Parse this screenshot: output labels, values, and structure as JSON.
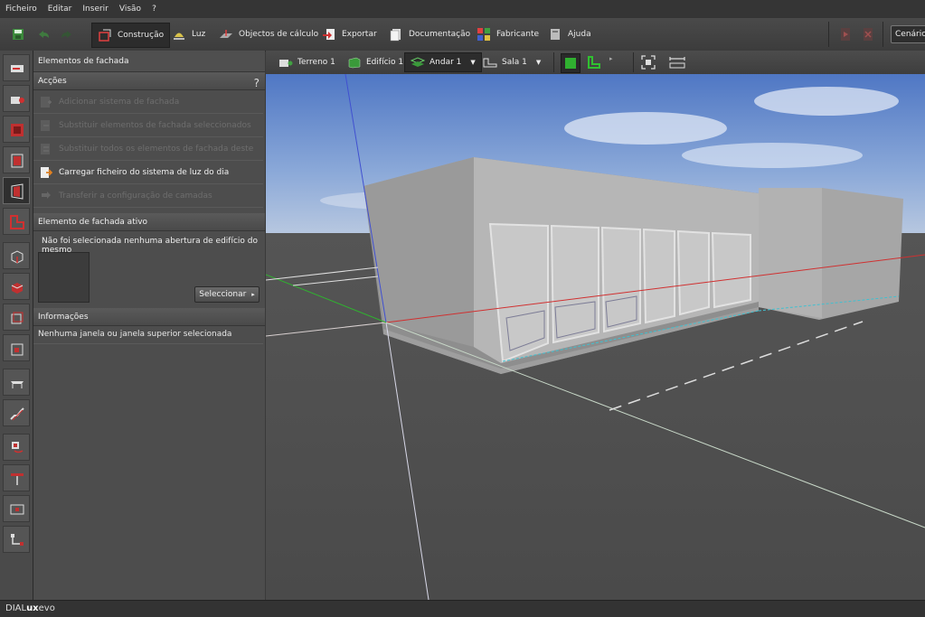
{
  "menu": [
    "Ficheiro",
    "Editar",
    "Inserir",
    "Visão",
    "?"
  ],
  "toolbar": {
    "construcao": "Construção",
    "luz": "Luz",
    "objectos": "Objectos de cálculo",
    "exportar": "Exportar",
    "documentacao": "Documentação",
    "fabricante": "Fabricante",
    "ajuda": "Ajuda",
    "cenario": "Cenário"
  },
  "panel": {
    "title": "Elementos de fachada",
    "accoes_header": "Acções",
    "help": "?",
    "actions": [
      "Adicionar sistema de fachada",
      "Substituir elementos de fachada seleccionados",
      "Substituir todos os elementos de fachada deste tipo",
      "Carregar ficheiro do sistema de luz do dia",
      "Transferir a configuração de camadas"
    ],
    "ativo_header": "Elemento de fachada ativo",
    "ativo_msg": "Não foi selecionada nenhuma abertura de edifício do mesmo",
    "seleccionar": "Seleccionar",
    "info_header": "Informações",
    "info_msg": "Nenhuma janela ou janela superior selecionada"
  },
  "viewtoolbar": {
    "terreno": "Terreno 1",
    "edificio": "Edifício 1",
    "andar": "Andar 1",
    "sala": "Sala 1"
  },
  "status": {
    "brand_a": "DIAL",
    "brand_b": "ux",
    "brand_c": "evo"
  }
}
